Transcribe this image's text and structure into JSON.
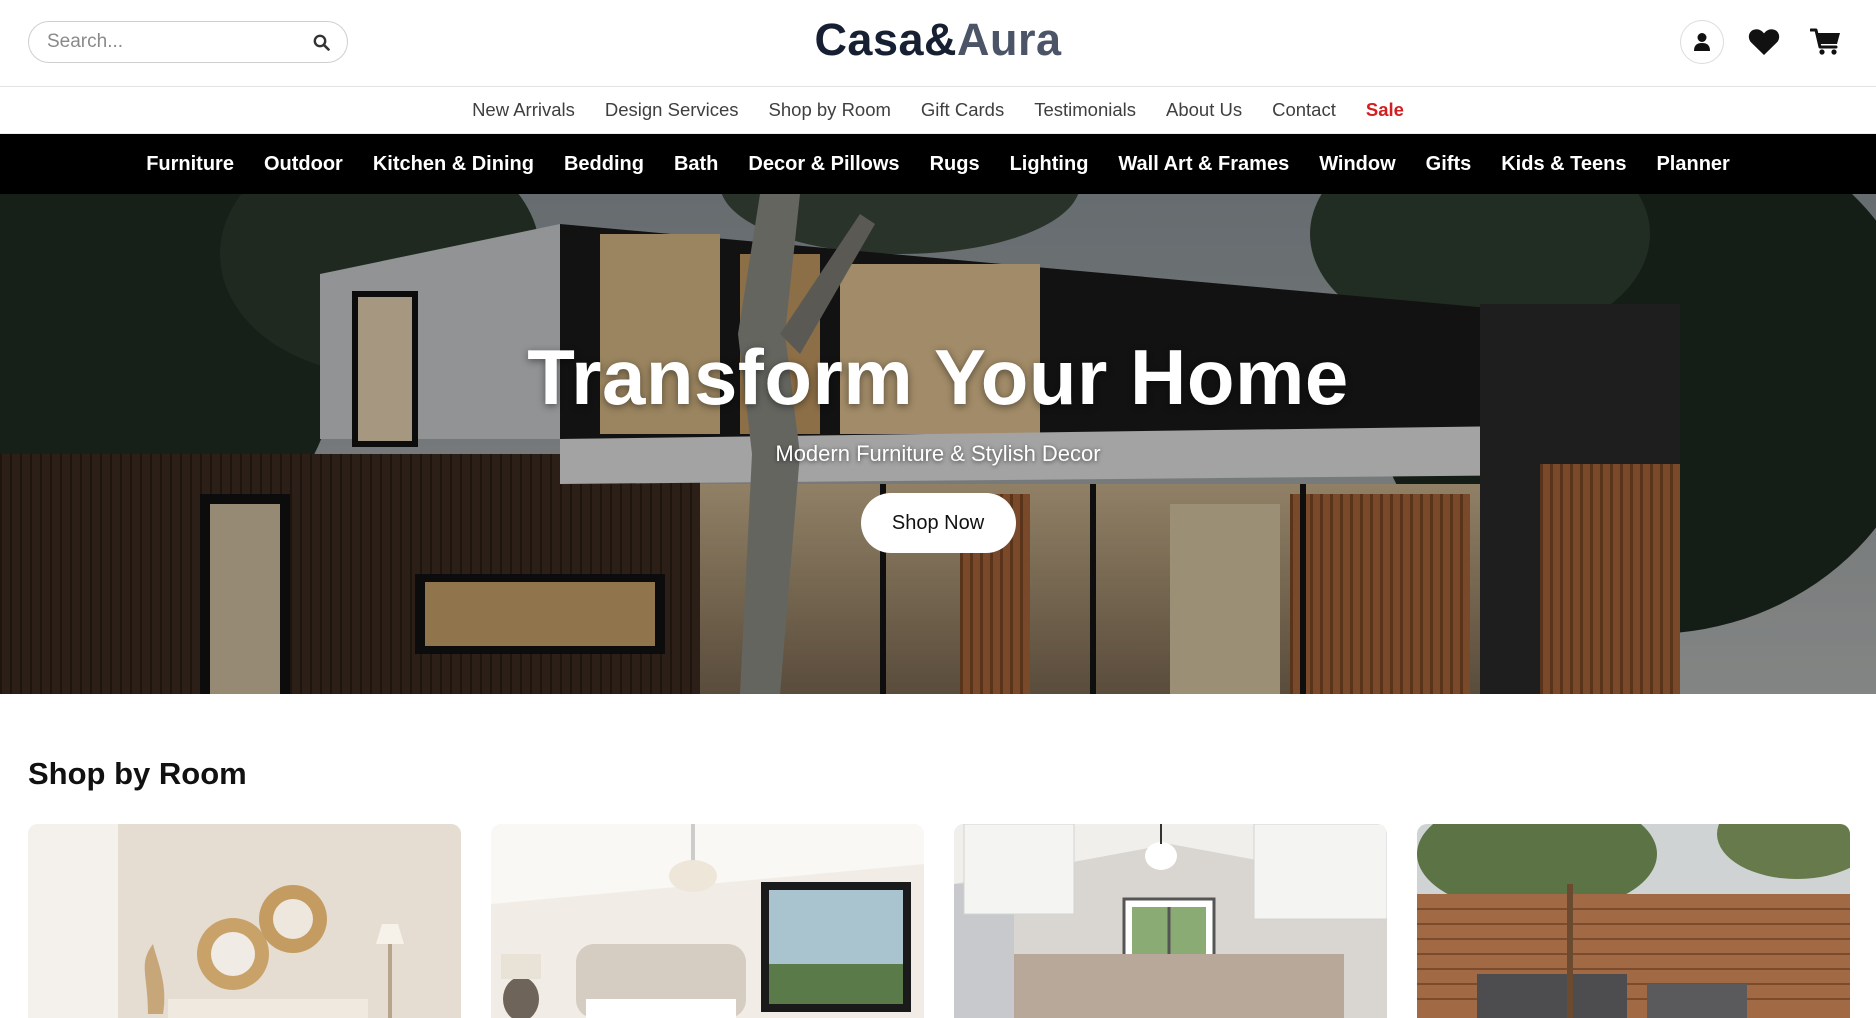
{
  "header": {
    "search": {
      "placeholder": "Search..."
    },
    "logo": {
      "part1": "Casa&",
      "part2": "Aura"
    },
    "icons": [
      "user-icon",
      "heart-icon",
      "cart-icon"
    ]
  },
  "secondary_nav": {
    "items": [
      "New Arrivals",
      "Design Services",
      "Shop by Room",
      "Gift Cards",
      "Testimonials",
      "About Us",
      "Contact",
      "Sale"
    ]
  },
  "main_nav": {
    "items": [
      "Furniture",
      "Outdoor",
      "Kitchen & Dining",
      "Bedding",
      "Bath",
      "Decor & Pillows",
      "Rugs",
      "Lighting",
      "Wall Art & Frames",
      "Window",
      "Gifts",
      "Kids & Teens",
      "Planner"
    ]
  },
  "hero": {
    "title": "Transform Your Home",
    "subtitle": "Modern Furniture & Stylish Decor",
    "cta": "Shop Now"
  },
  "shop_by_room": {
    "title": "Shop by Room"
  },
  "colors": {
    "sale": "#d21f1f",
    "nav_bg": "#000000",
    "logo_dark": "#172033",
    "logo_light": "#4b5567"
  }
}
